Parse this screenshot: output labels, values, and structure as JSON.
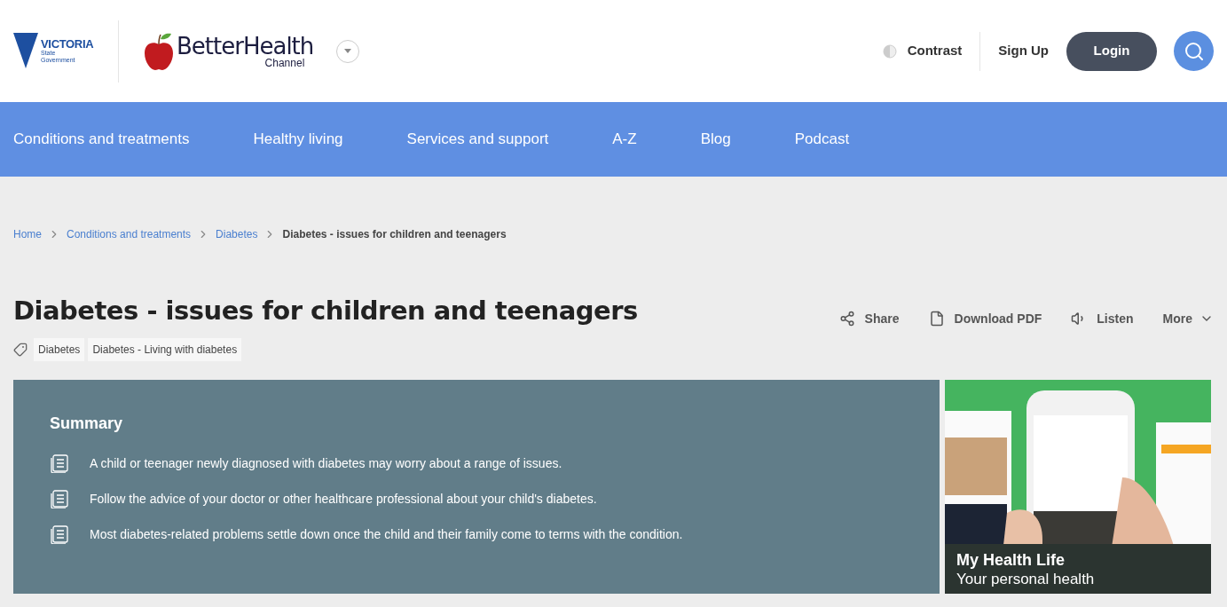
{
  "header": {
    "gov_logo": {
      "name": "VICTORIA",
      "sub": "State Government"
    },
    "site_logo": {
      "name": "BetterHealth",
      "sub": "Channel"
    },
    "contrast": "Contrast",
    "sign_up": "Sign Up",
    "login": "Login"
  },
  "nav": [
    "Conditions and treatments",
    "Healthy living",
    "Services and support",
    "A-Z",
    "Blog",
    "Podcast"
  ],
  "breadcrumb": [
    {
      "label": "Home",
      "link": true
    },
    {
      "label": "Conditions and treatments",
      "link": true
    },
    {
      "label": "Diabetes",
      "link": true
    },
    {
      "label": "Diabetes - issues for children and teenagers",
      "link": false
    }
  ],
  "title": "Diabetes - issues for children and teenagers",
  "actions": [
    {
      "kind": "share",
      "label": "Share"
    },
    {
      "kind": "pdf",
      "label": "Download PDF"
    },
    {
      "kind": "listen",
      "label": "Listen"
    },
    {
      "kind": "more",
      "label": "More"
    }
  ],
  "tags": [
    "Diabetes",
    "Diabetes - Living with diabetes"
  ],
  "summary": {
    "heading": "Summary",
    "items": [
      "A child or teenager newly diagnosed with diabetes may worry about a range of issues.",
      "Follow the advice of your doctor or other healthcare professional about your child's diabetes.",
      "Most diabetes-related problems settle down once the child and their family come to terms with the condition."
    ]
  },
  "promo": {
    "title": "My Health Life",
    "subtitle": "Your personal health"
  }
}
